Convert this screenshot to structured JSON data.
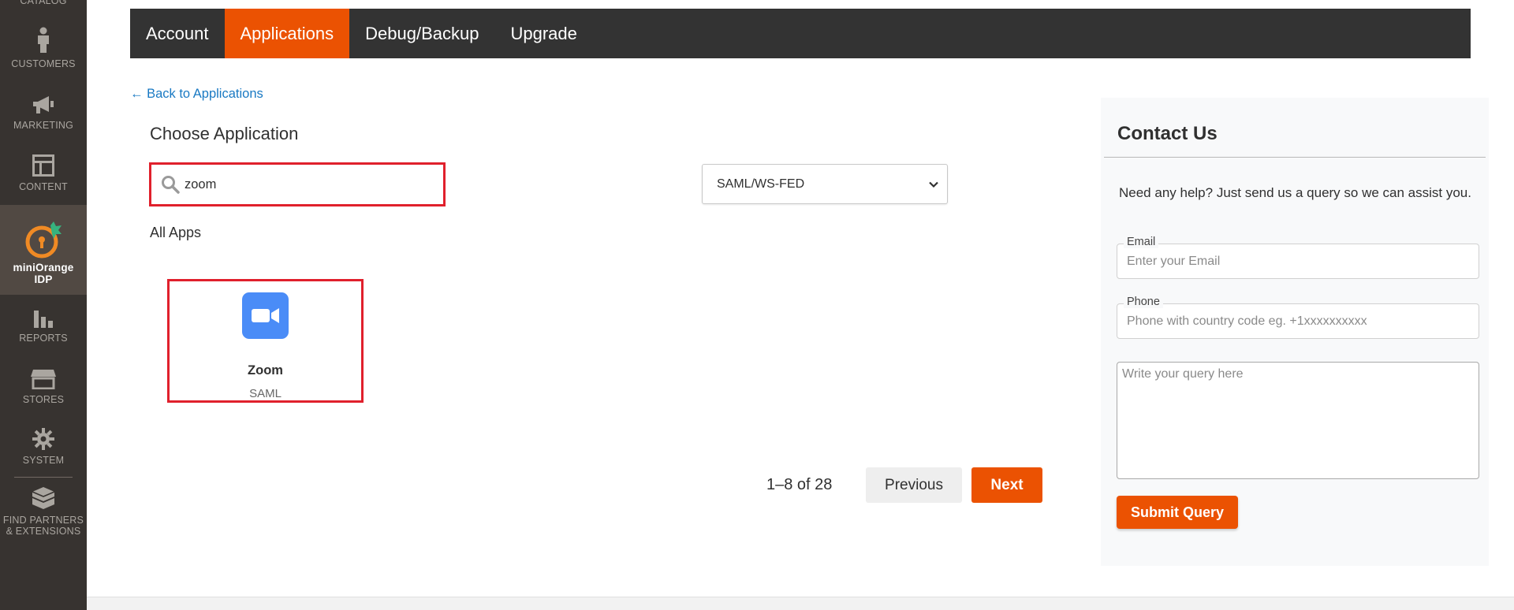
{
  "sidebar": {
    "items": [
      {
        "label": "Catalog",
        "icon": "catalog-icon"
      },
      {
        "label": "Customers",
        "icon": "person-icon"
      },
      {
        "label": "Marketing",
        "icon": "megaphone-icon"
      },
      {
        "label": "Content",
        "icon": "layout-icon"
      },
      {
        "label_line1": "miniOrange",
        "label_line2": "IDP",
        "icon": "miniorange-logo-icon",
        "active": true
      },
      {
        "label": "Reports",
        "icon": "bar-chart-icon"
      },
      {
        "label": "Stores",
        "icon": "storefront-icon"
      },
      {
        "label": "System",
        "icon": "gear-icon"
      },
      {
        "label_line1": "Find Partners",
        "label_line2": "& Extensions",
        "icon": "cube-stack-icon"
      }
    ]
  },
  "tabs": [
    {
      "label": "Account",
      "active": false
    },
    {
      "label": "Applications",
      "active": true
    },
    {
      "label": "Debug/Backup",
      "active": false
    },
    {
      "label": "Upgrade",
      "active": false
    }
  ],
  "main": {
    "back_link": "← Back to Applications",
    "title": "Choose Application",
    "search": {
      "value": "zoom",
      "icon": "search-icon"
    },
    "protocol_select": {
      "value": "SAML/WS-FED"
    },
    "section_label": "All Apps",
    "apps": [
      {
        "name": "Zoom",
        "type": "SAML",
        "icon": "video-camera-icon",
        "color": "#4a8cf7"
      }
    ],
    "pagination": {
      "range": "1–8 of 28",
      "previous": "Previous",
      "next": "Next"
    }
  },
  "contact": {
    "title": "Contact Us",
    "help": "Need any help? Just send us a query so we can assist you.",
    "email": {
      "label": "Email",
      "placeholder": "Enter your Email"
    },
    "phone": {
      "label": "Phone",
      "placeholder": "Phone with country code eg. +1xxxxxxxxxx"
    },
    "query": {
      "placeholder": "Write your query here"
    },
    "submit": "Submit Query"
  },
  "colors": {
    "accent": "#eb5202",
    "highlight": "#e0202c",
    "sidebar": "#373330",
    "link": "#1979c3"
  }
}
